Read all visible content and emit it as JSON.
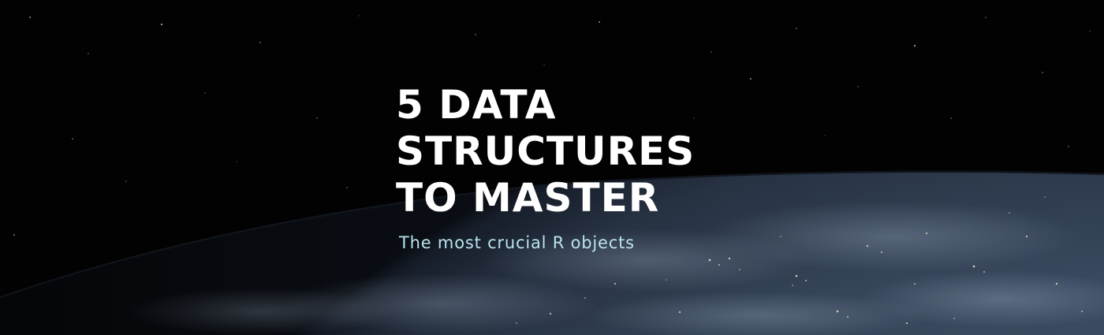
{
  "banner": {
    "headline_lines": [
      "5 DATA",
      "STRUCTURES",
      "TO MASTER"
    ],
    "subtitle": "The most crucial R objects"
  },
  "colors": {
    "space": "#020203",
    "earth_dark": "#1e2a3a",
    "earth_light": "#4a5a70",
    "city_lights": "#f3e7c6",
    "headline": "#ffffff",
    "subtitle": "#b8e3ec"
  },
  "background": {
    "scene": "earth-from-space-night"
  }
}
